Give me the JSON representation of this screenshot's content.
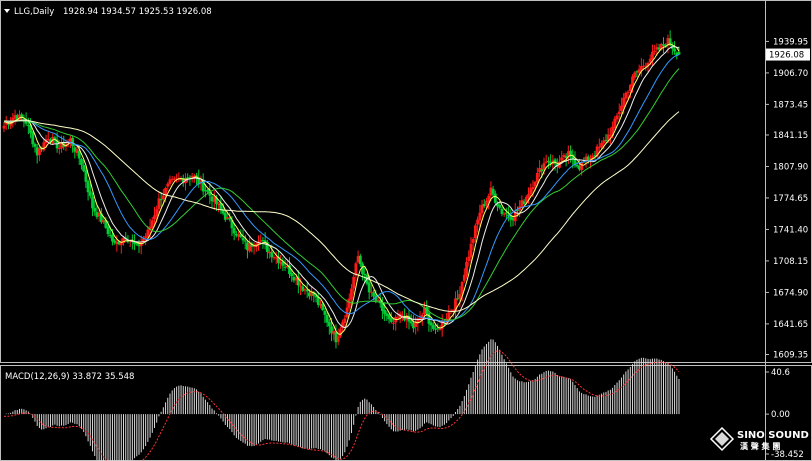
{
  "header": {
    "symbol": "LLG,Daily",
    "ohlc": "1928.94 1934.57 1925.53 1926.08"
  },
  "current_price_label": "1926.08",
  "macd_header": "MACD(12,26,9) 33.872 35.548",
  "logo": {
    "brand": "SINO SOUND",
    "sub": "漢 聲 集 團"
  },
  "colors": {
    "background": "#000000",
    "bull": "#ff1a1a",
    "bear": "#00cc33",
    "ma5": "#ffff66",
    "ma10": "#f0f0f0",
    "ma20": "#3399ff",
    "ma30": "#33cc33",
    "ma60": "#ffffcc",
    "macd_hist": "#d8d8d8",
    "macd_signal": "#ff3333"
  },
  "chart_data": [
    {
      "type": "candlestick",
      "series_name": "LLG,Daily",
      "yaxis_ticks": [
        1939.95,
        1906.7,
        1873.45,
        1841.15,
        1807.9,
        1774.65,
        1741.4,
        1708.15,
        1674.9,
        1641.65,
        1609.35
      ],
      "yaxis_tick_labels": [
        "1939.95",
        "1906.70",
        "1873.45",
        "1841.15",
        "1807.90",
        "1774.65",
        "1741.40",
        "1708.15",
        "1674.90",
        "1641.65",
        "1609.35"
      ],
      "ylim": [
        1603,
        1952
      ],
      "last": {
        "open": 1928.94,
        "high": 1934.57,
        "low": 1925.53,
        "close": 1926.08
      },
      "anchors": [
        1851,
        1862,
        1855,
        1822,
        1840,
        1828,
        1836,
        1812,
        1765,
        1748,
        1725,
        1735,
        1722,
        1738,
        1772,
        1790,
        1795,
        1799,
        1786,
        1772,
        1755,
        1738,
        1722,
        1732,
        1718,
        1708,
        1695,
        1680,
        1672,
        1650,
        1626,
        1658,
        1713,
        1675,
        1660,
        1640,
        1652,
        1638,
        1655,
        1632,
        1650,
        1668,
        1715,
        1760,
        1782,
        1760,
        1755,
        1772,
        1795,
        1815,
        1810,
        1820,
        1808,
        1818,
        1830,
        1848,
        1880,
        1905,
        1918,
        1930,
        1940,
        1926.08
      ]
    },
    {
      "type": "histogram",
      "series_name": "MACD(12,26,9)",
      "macd": 33.872,
      "signal": 35.548,
      "yaxis_tick_labels": [
        "40.6",
        "0.00",
        "-38.452"
      ],
      "yaxis_ticks": [
        40.6,
        0,
        -38.452
      ]
    }
  ]
}
